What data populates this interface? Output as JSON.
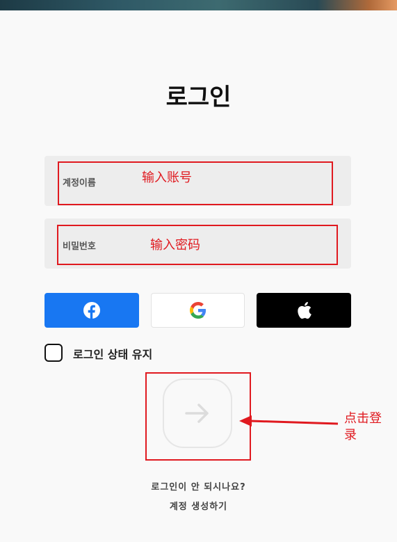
{
  "page": {
    "title": "로그인"
  },
  "form": {
    "username_label": "계정이름",
    "password_label": "비밀번호",
    "remember_label": "로그인 상태 유지"
  },
  "annotations": {
    "username_note": "输入账号",
    "password_note": "输入密码",
    "login_note_line1": "点击登",
    "login_note_line2": "录",
    "color": "#e0191f"
  },
  "social": {
    "facebook_icon": "facebook-icon",
    "google_icon": "google-icon",
    "apple_icon": "apple-icon",
    "facebook_color": "#1877f2",
    "apple_color": "#000000"
  },
  "links": {
    "trouble": "로그인이 안 되시나요?",
    "create_account": "계정 생성하기"
  }
}
